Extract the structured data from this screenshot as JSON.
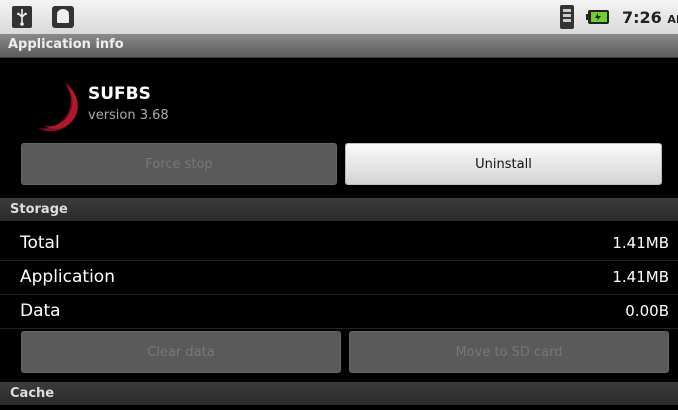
{
  "status_bar": {
    "time": "7:26",
    "ampm": "AM"
  },
  "title_bar": {
    "title": "Application info"
  },
  "app": {
    "name": "SUFBS",
    "version": "version 3.68"
  },
  "buttons": {
    "force_stop": "Force stop",
    "uninstall": "Uninstall",
    "clear_data": "Clear data",
    "move_to_sd": "Move to SD card"
  },
  "storage": {
    "header": "Storage",
    "rows": [
      {
        "label": "Total",
        "value": "1.41MB"
      },
      {
        "label": "Application",
        "value": "1.41MB"
      },
      {
        "label": "Data",
        "value": "0.00B"
      }
    ]
  },
  "cache": {
    "header": "Cache"
  }
}
